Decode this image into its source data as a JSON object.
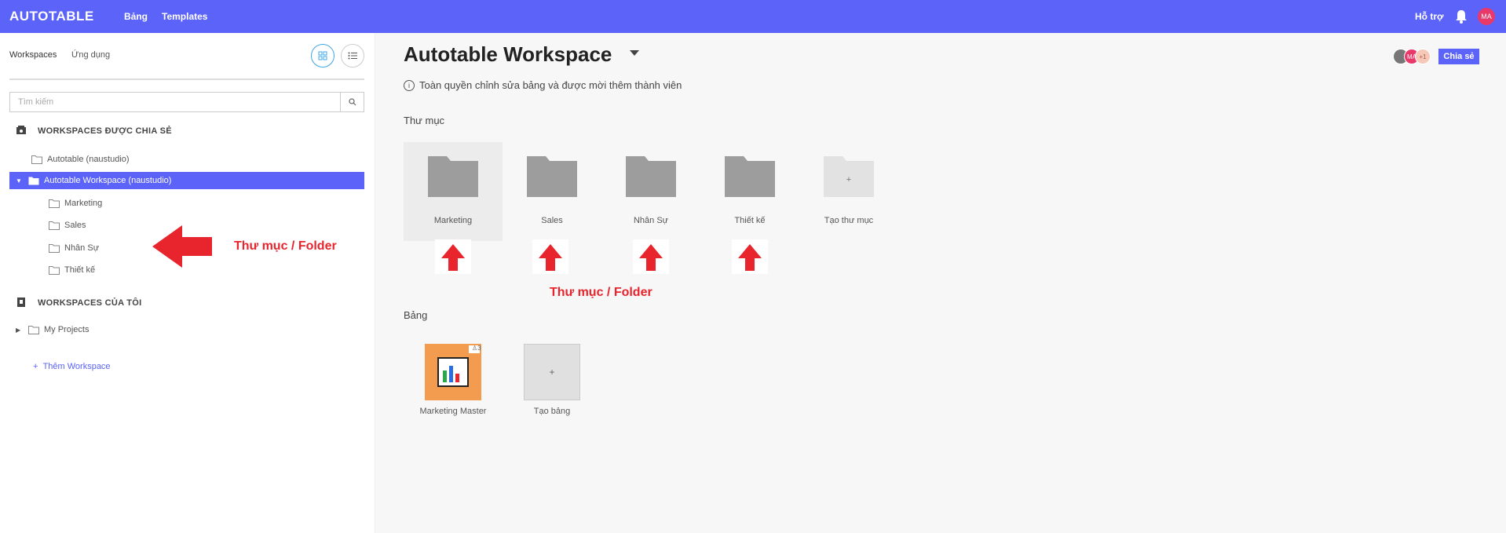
{
  "topbar": {
    "logo": "AUTOTABLE",
    "nav": [
      "Bảng",
      "Templates"
    ],
    "support": "Hỗ trợ",
    "avatar": "MA"
  },
  "sidebar": {
    "tabs": [
      "Workspaces",
      "Ứng dụng"
    ],
    "search_placeholder": "Tìm kiếm",
    "shared_title": "WORKSPACES ĐƯỢC CHIA SẺ",
    "shared_items": [
      {
        "label": "Autotable (naustudio)"
      },
      {
        "label": "Autotable Workspace (naustudio)"
      },
      {
        "label": "Marketing"
      },
      {
        "label": "Sales"
      },
      {
        "label": "Nhân Sự"
      },
      {
        "label": "Thiết kế"
      }
    ],
    "mine_title": "WORKSPACES CỦA TÔI",
    "mine_items": [
      {
        "label": "My Projects"
      }
    ],
    "add_workspace": "Thêm Workspace",
    "annotation": "Thư mục / Folder"
  },
  "main": {
    "title": "Autotable Workspace",
    "permission": "Toàn quyền chỉnh sửa bảng và được mời thêm thành viên",
    "share_button": "Chia sẻ",
    "members": [
      "",
      "MA",
      "+1"
    ],
    "folders_label": "Thư mục",
    "folders": [
      "Marketing",
      "Sales",
      "Nhân Sự",
      "Thiết kế",
      "Tạo thư mục"
    ],
    "folder_annotation": "Thư mục / Folder",
    "tables_label": "Bảng",
    "tables": [
      {
        "name": "Marketing Master",
        "badge": "3"
      },
      {
        "name": "Tạo bảng"
      }
    ],
    "plus": "+"
  },
  "colors": {
    "accent": "#5b63f8",
    "annotation_red": "#e8242c",
    "table_thumb": "#f39b4e"
  }
}
